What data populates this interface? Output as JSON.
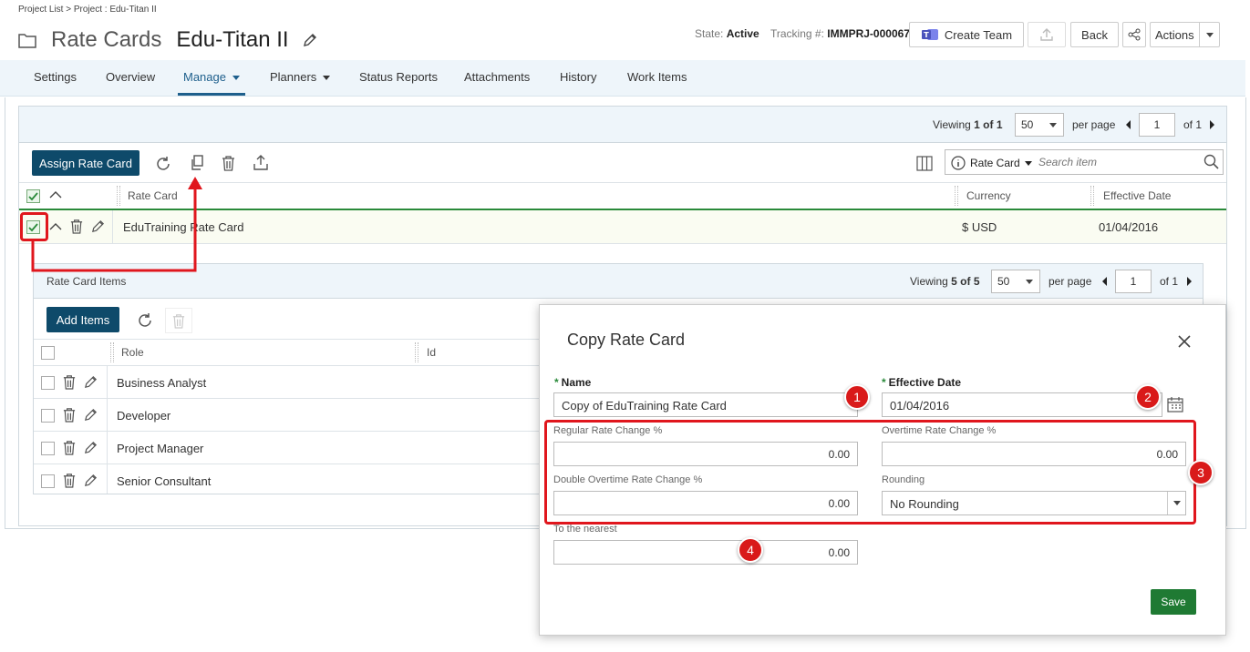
{
  "breadcrumb": "Project List > Project : Edu-Titan II",
  "title": {
    "prefix": "Rate Cards",
    "name": "Edu-Titan II"
  },
  "header": {
    "state_label": "State:",
    "state_value": "Active",
    "tracking_label": "Tracking #:",
    "tracking_value": "IMMPRJ-000067",
    "create_team_label": "Create Team",
    "back_label": "Back",
    "actions_label": "Actions"
  },
  "tabs": [
    {
      "label": "Settings"
    },
    {
      "label": "Overview"
    },
    {
      "label": "Manage"
    },
    {
      "label": "Planners"
    },
    {
      "label": "Status Reports"
    },
    {
      "label": "Attachments"
    },
    {
      "label": "History"
    },
    {
      "label": "Work Items"
    }
  ],
  "pager": {
    "viewing_label": "Viewing",
    "viewing_count": "1 of 1",
    "per_page_value": "50",
    "per_page_label": "per page",
    "page": "1",
    "of_label": "of 1"
  },
  "toolbar": {
    "assign_label": "Assign Rate Card",
    "search_field": "Rate Card",
    "search_placeholder": "Search item"
  },
  "table": {
    "headers": {
      "rate_card": "Rate Card",
      "currency": "Currency",
      "effective_date": "Effective Date"
    },
    "rows": [
      {
        "rate_card": "EduTraining Rate Card",
        "currency": "$ USD",
        "effective_date": "01/04/2016"
      }
    ]
  },
  "items_panel": {
    "title": "Rate Card Items",
    "viewing_label": "Viewing",
    "viewing_count": "5 of 5",
    "per_page_value": "50",
    "per_page_label": "per page",
    "page": "1",
    "of_label": "of 1",
    "add_label": "Add Items",
    "headers": {
      "role": "Role",
      "id": "Id"
    },
    "rows": [
      {
        "role": "Business Analyst"
      },
      {
        "role": "Developer"
      },
      {
        "role": "Project Manager"
      },
      {
        "role": "Senior Consultant"
      }
    ]
  },
  "modal": {
    "title": "Copy Rate Card",
    "name_label": "Name",
    "name_value": "Copy of EduTraining Rate Card",
    "effective_date_label": "Effective Date",
    "effective_date_value": "01/04/2016",
    "regular_label": "Regular Rate Change %",
    "regular_value": "0.00",
    "overtime_label": "Overtime Rate Change %",
    "overtime_value": "0.00",
    "double_label": "Double Overtime Rate Change %",
    "double_value": "0.00",
    "rounding_label": "Rounding",
    "rounding_value": "No Rounding",
    "nearest_label": "To the nearest",
    "nearest_value": "0.00",
    "save_label": "Save"
  },
  "callouts": [
    "1",
    "2",
    "3",
    "4"
  ],
  "colors": {
    "primary": "#0e4a6a",
    "accent": "#1e5f8c",
    "save": "#1f7a33",
    "callout": "#d91a1a",
    "highlight": "#e0161d"
  }
}
